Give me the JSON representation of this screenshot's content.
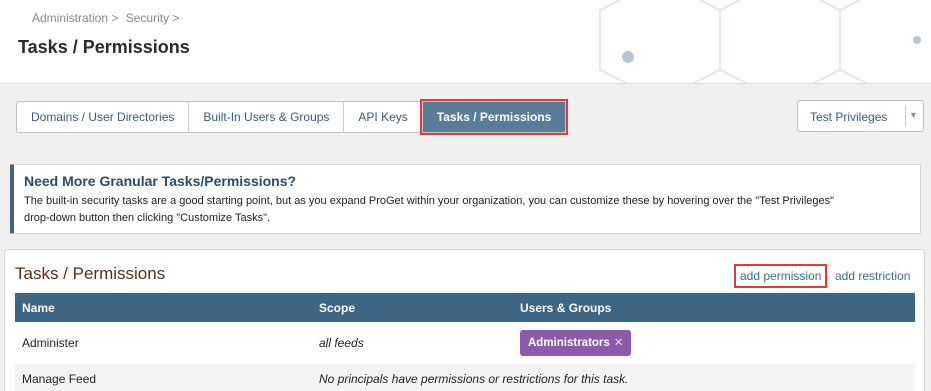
{
  "breadcrumb": {
    "items": [
      "Administration >",
      "Security >"
    ]
  },
  "page": {
    "title": "Tasks / Permissions"
  },
  "tabs": [
    {
      "label": "Domains / User Directories"
    },
    {
      "label": "Built-In Users & Groups"
    },
    {
      "label": "API Keys"
    },
    {
      "label": "Tasks / Permissions",
      "active": true
    }
  ],
  "privileges_dropdown": {
    "label": "Test Privileges",
    "icon": "chevron-down-icon"
  },
  "info": {
    "title": "Need More Granular Tasks/Permissions?",
    "line1": "The built-in security tasks are a good starting point, but as you expand ProGet within your organization, you can customize these by hovering over the \"Test Privileges\"",
    "line2": "drop-down button then clicking \"Customize Tasks\"."
  },
  "panel": {
    "title": "Tasks / Permissions",
    "add_permission": "add permission",
    "add_restriction": "add restriction"
  },
  "table": {
    "headers": {
      "name": "Name",
      "scope": "Scope",
      "users": "Users & Groups"
    },
    "rows": [
      {
        "name": "Administer",
        "scope": "all feeds",
        "principal": "Administrators",
        "remove_icon": "close-icon"
      },
      {
        "name": "Manage Feed",
        "scope": "No principals have permissions or restrictions for this task."
      }
    ]
  },
  "colors": {
    "active_tab": "#5a7c98",
    "table_header": "#3f6584",
    "chip": "#8d5aab",
    "highlight": "#e03a3a"
  }
}
